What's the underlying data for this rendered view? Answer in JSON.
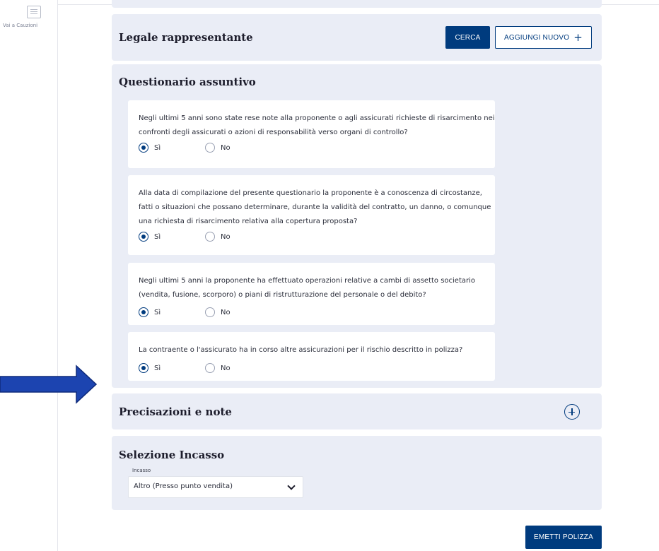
{
  "sidebar": {
    "vai_label": "Vai a Cauzioni"
  },
  "legale": {
    "title": "Legale rappresentante",
    "cerca_label": "CERCA",
    "aggiungi_label": "AGGIUNGI NUOVO",
    "plus_glyph": "+"
  },
  "questionario": {
    "title": "Questionario assuntivo",
    "questions": [
      {
        "text": "Negli ultimi 5 anni sono state rese note alla proponente o agli assicurati richieste di risarcimento nei confronti degli assicurati o azioni di responsabilità verso organi di controllo?",
        "yes_label": "Sì",
        "no_label": "No",
        "selected": "Sì"
      },
      {
        "text": "Alla data di compilazione del presente questionario la proponente è a conoscenza di circostanze, fatti o situazioni che possano determinare, durante la validità del contratto, un danno, o comunque una richiesta di risarcimento relativa alla copertura proposta?",
        "yes_label": "Sì",
        "no_label": "No",
        "selected": "Sì"
      },
      {
        "text": "Negli ultimi 5 anni la proponente ha effettuato operazioni relative a cambi di assetto societario (vendita, fusione, scorporo) o piani di ristrutturazione del personale o del debito?",
        "yes_label": "Sì",
        "no_label": "No",
        "selected": "Sì"
      },
      {
        "text": "La contraente o l'assicurato ha in corso altre assicurazioni per il rischio descritto in polizza?",
        "yes_label": "Sì",
        "no_label": "No",
        "selected": "Sì"
      }
    ]
  },
  "precisazioni": {
    "title": "Precisazioni e note"
  },
  "incasso": {
    "title": "Selezione Incasso",
    "field_label": "Incasso",
    "selected_value": "Altro (Presso punto vendita)"
  },
  "footer": {
    "emetti_label": "EMETTI POLIZZA"
  },
  "colors": {
    "brand": "#003b7e",
    "panel_bg": "#eaedf6",
    "arrow": "#1c44b0"
  }
}
